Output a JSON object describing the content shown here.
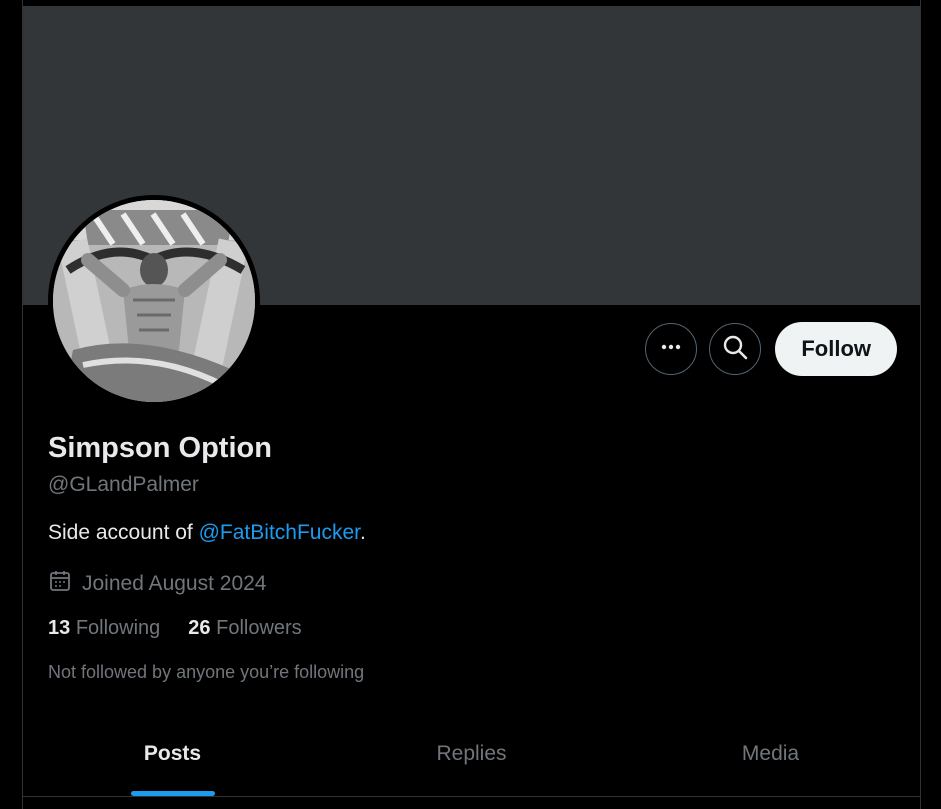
{
  "profile": {
    "display_name": "Simpson Option",
    "handle": "@GLandPalmer",
    "bio_prefix": "Side account of ",
    "bio_mention": "@FatBitchFucker",
    "bio_suffix": ".",
    "joined": "Joined August 2024",
    "following_count": "13",
    "following_label": "Following",
    "followers_count": "26",
    "followers_label": "Followers",
    "not_followed_note": "Not followed by anyone you’re following"
  },
  "actions": {
    "follow_label": "Follow",
    "more_icon": "more-icon",
    "search_icon": "search-icon"
  },
  "tabs": [
    {
      "label": "Posts",
      "active": true
    },
    {
      "label": "Replies",
      "active": false
    },
    {
      "label": "Media",
      "active": false
    }
  ],
  "colors": {
    "banner": "#323639",
    "accent": "#1d9bf0",
    "follow_bg": "#eff3f4",
    "muted_text": "#71767b"
  }
}
